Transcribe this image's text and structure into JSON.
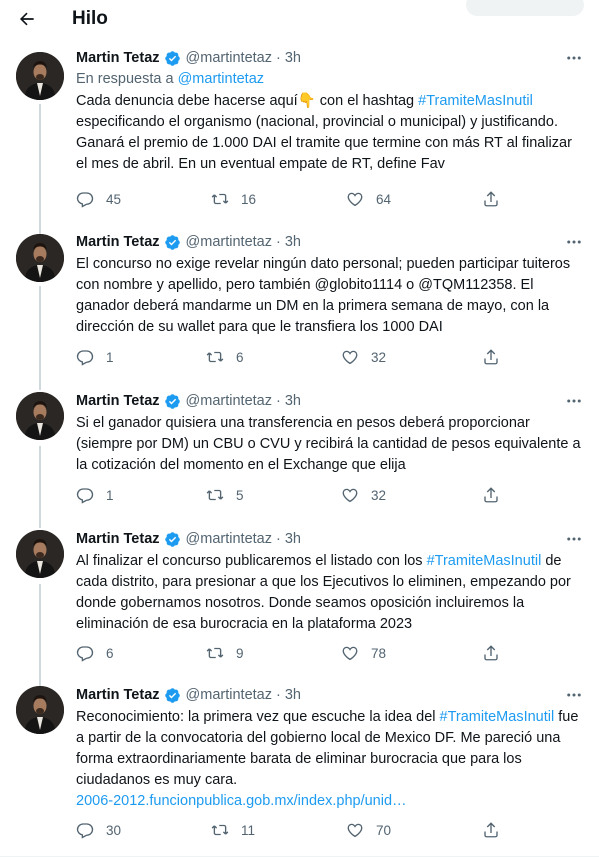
{
  "header": {
    "title": "Hilo",
    "back_icon": "arrow-left-icon"
  },
  "colors": {
    "accent": "#1d9bf0",
    "text": "#0f1419",
    "secondary": "#536471",
    "divider": "#eff3f4"
  },
  "tweets": [
    {
      "name": "Martin Tetaz",
      "handle": "@martintetaz",
      "time": "3h",
      "reply_prefix": "En respuesta a ",
      "reply_handle": "@martintetaz",
      "text_parts": [
        "Cada denuncia debe hacerse aquí👇 con el hashtag ",
        "#TramiteMasInutil",
        " especificando el organismo (nacional, provincial o municipal) y justificando. Ganará el premio de 1.000 DAI el tramite que termine con más RT al finalizar el mes de abril. En un eventual empate de RT, define Fav"
      ],
      "replies": "45",
      "retweets": "16",
      "likes": "64"
    },
    {
      "name": "Martin Tetaz",
      "handle": "@martintetaz",
      "time": "3h",
      "text": "El concurso no exige revelar ningún dato personal; pueden participar tuiteros con nombre y apellido, pero también @globito1114 o @TQM112358. El ganador deberá mandarme un DM en la primera semana de mayo, con la dirección de su wallet para que le transfiera los 1000 DAI",
      "replies": "1",
      "retweets": "6",
      "likes": "32"
    },
    {
      "name": "Martin Tetaz",
      "handle": "@martintetaz",
      "time": "3h",
      "text": "Si el ganador quisiera una transferencia en pesos deberá proporcionar (siempre por DM) un CBU o CVU y recibirá la cantidad de pesos equivalente a la cotización del momento en el Exchange que elija",
      "replies": "1",
      "retweets": "5",
      "likes": "32"
    },
    {
      "name": "Martin Tetaz",
      "handle": "@martintetaz",
      "time": "3h",
      "text_parts": [
        "Al finalizar el concurso publicaremos el listado con los ",
        "#TramiteMasInutil",
        " de cada distrito, para presionar a que los Ejecutivos lo eliminen, empezando por donde gobernamos nosotros. Donde seamos oposición incluiremos la eliminación de esa burocracia en la plataforma 2023"
      ],
      "replies": "6",
      "retweets": "9",
      "likes": "78"
    },
    {
      "name": "Martin Tetaz",
      "handle": "@martintetaz",
      "time": "3h",
      "text_parts": [
        "Reconocimiento: la primera vez que escuche la idea del ",
        "#TramiteMasInutil",
        " fue a partir de la convocatoria del gobierno local de Mexico DF. Me pareció una forma extraordinariamente barata de eliminar burocracia que para los ciudadanos es muy cara."
      ],
      "link": "2006-2012.funcionpublica.gob.mx/index.php/unid…",
      "replies": "30",
      "retweets": "11",
      "likes": "70"
    }
  ],
  "icons": {
    "verified": "verified-badge-icon",
    "more": "more-icon",
    "reply": "reply-icon",
    "retweet": "retweet-icon",
    "like": "like-icon",
    "share": "share-icon"
  }
}
